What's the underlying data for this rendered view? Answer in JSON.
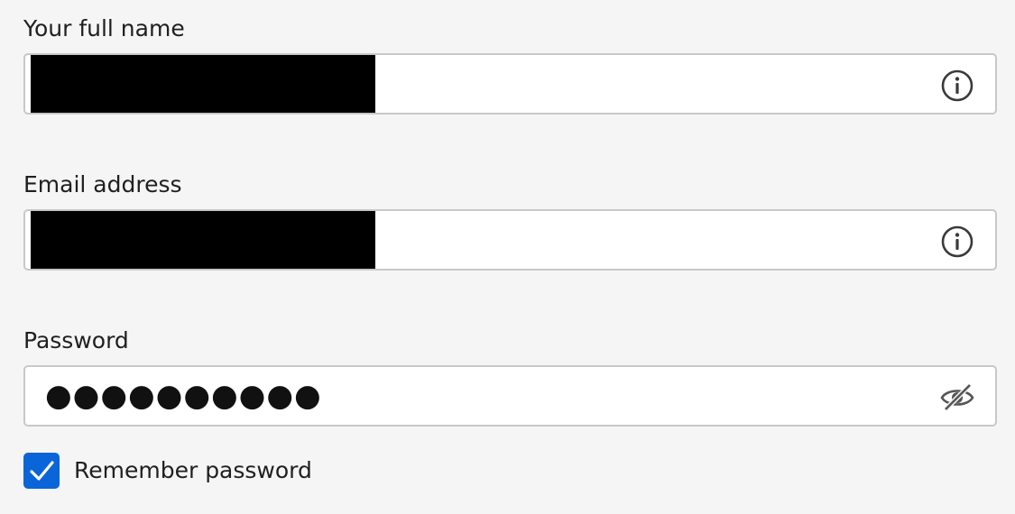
{
  "form": {
    "name": {
      "label": "Your full name",
      "value_redacted": true,
      "trailing_icon": "info-icon"
    },
    "email": {
      "label": "Email address",
      "value_redacted": true,
      "trailing_icon": "info-icon"
    },
    "password": {
      "label": "Password",
      "masked_value": "●●●●●●●●●●",
      "trailing_icon": "eye-slash-icon"
    },
    "remember": {
      "label": "Remember password",
      "checked": true
    }
  },
  "colors": {
    "background": "#f5f5f5",
    "input_border": "#c8c8c8",
    "checkbox_accent": "#0a65d8",
    "redaction": "#000000"
  }
}
